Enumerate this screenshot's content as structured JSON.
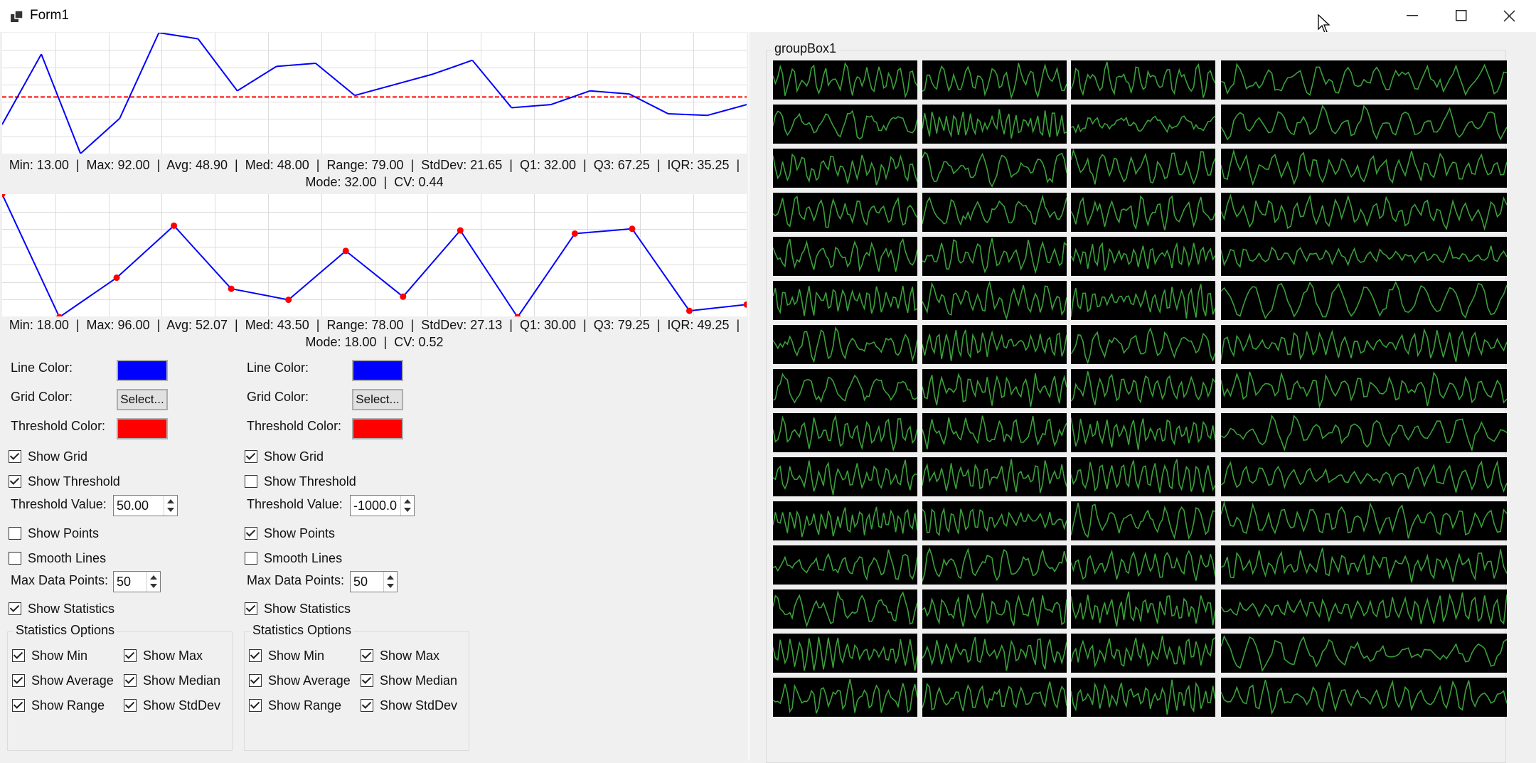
{
  "window": {
    "title": "Form1",
    "minimize_icon": "minimize-icon",
    "maximize_icon": "maximize-icon",
    "close_icon": "close-icon"
  },
  "colors": {
    "line": "#0000ff",
    "threshold": "#ff0000",
    "spark_line": "#3aa03a",
    "spark_bg": "#000000"
  },
  "charts": [
    {
      "stats_line1": "Min: 13.00  |  Max: 92.00  |  Avg: 48.90  |  Med: 48.00  |  Range: 79.00  |  StdDev: 21.65  |  Q1: 32.00  |  Q3: 67.25  |  IQR: 35.25  |",
      "stats_line2": "Mode: 32.00  |  CV: 0.44"
    },
    {
      "stats_line1": "Min: 18.00  |  Max: 96.00  |  Avg: 52.07  |  Med: 43.50  |  Range: 78.00  |  StdDev: 27.13  |  Q1: 30.00  |  Q3: 79.25  |  IQR: 49.25  |",
      "stats_line2": "Mode: 18.00  |  CV: 0.52"
    }
  ],
  "chart_data": [
    {
      "type": "line",
      "values": [
        32,
        78,
        13,
        36,
        92,
        88,
        54,
        70,
        72,
        51,
        58,
        65,
        74,
        43,
        45,
        54,
        52,
        39,
        38,
        45
      ],
      "threshold": 50,
      "show_grid": true,
      "show_threshold": true,
      "show_points": false
    },
    {
      "type": "line",
      "values": [
        96,
        18,
        43,
        76,
        36,
        29,
        60,
        31,
        73,
        18,
        71,
        74,
        22,
        26
      ],
      "show_grid": true,
      "show_threshold": false,
      "show_points": true
    }
  ],
  "settings": [
    {
      "line_color_label": "Line Color:",
      "grid_color_label": "Grid Color:",
      "threshold_color_label": "Threshold Color:",
      "select_label": "Select...",
      "show_grid": "Show Grid",
      "show_threshold": "Show Threshold",
      "threshold_value_label": "Threshold Value:",
      "threshold_value": "50.00",
      "show_points": "Show Points",
      "smooth_lines": "Smooth Lines",
      "max_points_label": "Max Data Points:",
      "max_points": "50",
      "show_statistics": "Show Statistics",
      "stats_options_title": "Statistics Options",
      "show_min": "Show Min",
      "show_max": "Show Max",
      "show_average": "Show Average",
      "show_median": "Show Median",
      "show_range": "Show Range",
      "show_stddev": "Show StdDev",
      "checked": {
        "grid": true,
        "threshold": true,
        "points": false,
        "smooth": false,
        "statistics": true,
        "min": true,
        "max": true,
        "average": true,
        "median": true,
        "range": true,
        "stddev": true
      }
    },
    {
      "line_color_label": "Line Color:",
      "grid_color_label": "Grid Color:",
      "threshold_color_label": "Threshold Color:",
      "select_label": "Select...",
      "show_grid": "Show Grid",
      "show_threshold": "Show Threshold",
      "threshold_value_label": "Threshold Value:",
      "threshold_value": "-1000.0",
      "show_points": "Show Points",
      "smooth_lines": "Smooth Lines",
      "max_points_label": "Max Data Points:",
      "max_points": "50",
      "show_statistics": "Show Statistics",
      "stats_options_title": "Statistics Options",
      "show_min": "Show Min",
      "show_max": "Show Max",
      "show_average": "Show Average",
      "show_median": "Show Median",
      "show_range": "Show Range",
      "show_stddev": "Show StdDev",
      "checked": {
        "grid": true,
        "threshold": false,
        "points": true,
        "smooth": false,
        "statistics": true,
        "min": true,
        "max": true,
        "average": true,
        "median": true,
        "range": true,
        "stddev": true
      }
    }
  ],
  "groupbox": {
    "title": "groupBox1",
    "rows": 15,
    "cols": 4
  }
}
